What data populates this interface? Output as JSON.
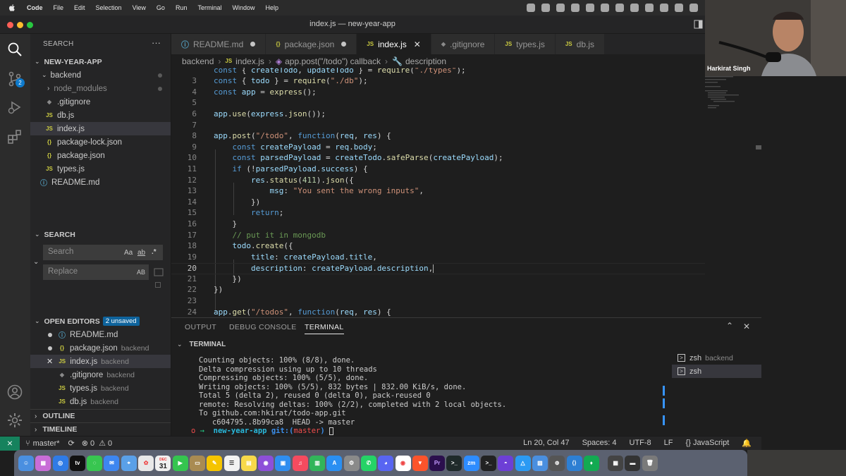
{
  "menubar": {
    "app_name": "Code",
    "items": [
      "File",
      "Edit",
      "Selection",
      "View",
      "Go",
      "Run",
      "Terminal",
      "Window",
      "Help"
    ]
  },
  "window_title": "index.js — new-year-app",
  "activity_badge": "2",
  "explorer": {
    "title": "SEARCH",
    "project": "NEW-YEAR-APP",
    "items": [
      {
        "label": "backend",
        "type": "folder"
      },
      {
        "label": "node_modules",
        "type": "folder"
      },
      {
        "label": ".gitignore",
        "type": "git"
      },
      {
        "label": "db.js",
        "type": "js"
      },
      {
        "label": "index.js",
        "type": "js"
      },
      {
        "label": "package-lock.json",
        "type": "json"
      },
      {
        "label": "package.json",
        "type": "json"
      },
      {
        "label": "types.js",
        "type": "js"
      },
      {
        "label": "README.md",
        "type": "md"
      }
    ]
  },
  "search": {
    "title": "SEARCH",
    "search_placeholder": "Search",
    "replace_placeholder": "Replace",
    "opt_case": "Aa",
    "opt_word": "ab",
    "opt_regex": ".*",
    "opt_preserve": "AB"
  },
  "open_editors": {
    "title": "OPEN EDITORS",
    "badge": "2 unsaved",
    "items": [
      {
        "label": "README.md",
        "desc": ""
      },
      {
        "label": "package.json",
        "desc": "backend"
      },
      {
        "label": "index.js",
        "desc": "backend"
      },
      {
        "label": ".gitignore",
        "desc": "backend"
      },
      {
        "label": "types.js",
        "desc": "backend"
      },
      {
        "label": "db.js",
        "desc": "backend"
      }
    ]
  },
  "outline_title": "OUTLINE",
  "timeline_title": "TIMELINE",
  "tabs": [
    "README.md",
    "package.json",
    "index.js",
    ".gitignore",
    "types.js",
    "db.js"
  ],
  "breadcrumb": [
    "backend",
    "index.js",
    "app.post(\"/todo\") callback",
    "description"
  ],
  "editor": {
    "current_line": "20",
    "lines": [
      {
        "n": "",
        "text": "const { createTodo, updateTodo } = require(\"./types\");"
      },
      {
        "n": "3",
        "text": "const { todo } = require(\"./db\");"
      },
      {
        "n": "4",
        "text": "const app = express();"
      },
      {
        "n": "5",
        "text": ""
      },
      {
        "n": "6",
        "text": "app.use(express.json());"
      },
      {
        "n": "7",
        "text": ""
      },
      {
        "n": "8",
        "text": "app.post(\"/todo\", function(req, res) {"
      },
      {
        "n": "9",
        "text": "    const createPayload = req.body;"
      },
      {
        "n": "10",
        "text": "    const parsedPayload = createTodo.safeParse(createPayload);"
      },
      {
        "n": "11",
        "text": "    if (!parsedPayload.success) {"
      },
      {
        "n": "12",
        "text": "        res.status(411).json({"
      },
      {
        "n": "13",
        "text": "            msg: \"You sent the wrong inputs\","
      },
      {
        "n": "14",
        "text": "        })"
      },
      {
        "n": "15",
        "text": "        return;"
      },
      {
        "n": "16",
        "text": "    }"
      },
      {
        "n": "17",
        "text": "    // put it in mongodb"
      },
      {
        "n": "18",
        "text": "    todo.create({"
      },
      {
        "n": "19",
        "text": "        title: createPayload.title,"
      },
      {
        "n": "20",
        "text": "        description: createPayload.description,"
      },
      {
        "n": "21",
        "text": "    })"
      },
      {
        "n": "22",
        "text": "})"
      },
      {
        "n": "23",
        "text": ""
      },
      {
        "n": "24",
        "text": "app.get(\"/todos\", function(req, res) {"
      }
    ]
  },
  "panel": {
    "tabs": [
      "OUTPUT",
      "DEBUG CONSOLE",
      "TERMINAL"
    ],
    "section": "TERMINAL",
    "terminal_lines": [
      "Counting objects: 100% (8/8), done.",
      "Delta compression using up to 10 threads",
      "Compressing objects: 100% (5/5), done.",
      "Writing objects: 100% (5/5), 832 bytes | 832.00 KiB/s, done.",
      "Total 5 (delta 2), reused 0 (delta 0), pack-reused 0",
      "remote: Resolving deltas: 100% (2/2), completed with 2 local objects.",
      "To github.com:hkirat/todo-app.git",
      "   c604795..8b99ca8  HEAD -> master"
    ],
    "prompt_dir": "new-year-app",
    "prompt_git": "git:(",
    "prompt_branch": "master",
    "prompt_git_end": ")",
    "terminals": [
      {
        "name": "zsh",
        "desc": "backend"
      },
      {
        "name": "zsh",
        "desc": ""
      }
    ]
  },
  "statusbar": {
    "branch": "master*",
    "errors": "0",
    "warnings": "0",
    "position": "Ln 20, Col 47",
    "spaces": "Spaces: 4",
    "encoding": "UTF-8",
    "eol": "LF",
    "language": "JavaScript"
  },
  "webcam": {
    "name": "Harkirat Singh"
  },
  "dock": {
    "calendar_day": "31",
    "calendar_month": "DEC"
  }
}
